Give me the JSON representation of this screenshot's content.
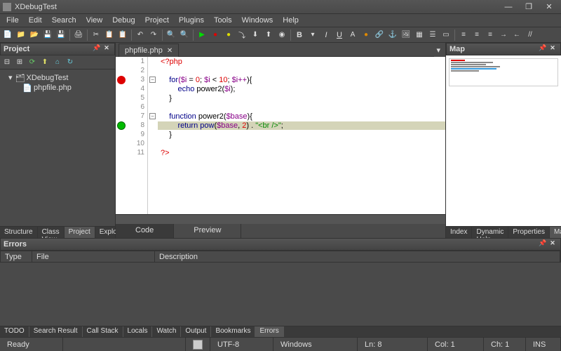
{
  "title": "XDebugTest",
  "menu": [
    "File",
    "Edit",
    "Search",
    "View",
    "Debug",
    "Project",
    "Plugins",
    "Tools",
    "Windows",
    "Help"
  ],
  "left_panel": {
    "title": "Project"
  },
  "tree": {
    "root": "XDebugTest",
    "file": "phpfile.php"
  },
  "left_tabs": [
    "Structure",
    "Class View",
    "Project",
    "Explorer"
  ],
  "left_tab_active": "Project",
  "file_tab": "phpfile.php",
  "code": {
    "l1": "<?php",
    "l3a": "for",
    "l3b": "($i",
    "l3c": " = ",
    "l3d": "0",
    "l3e": "; ",
    "l3f": "$i",
    "l3g": " < ",
    "l3h": "10",
    "l3i": "; ",
    "l3j": "$i++",
    "l3k": "){",
    "l4a": "echo",
    "l4b": " power2(",
    "l4c": "$i",
    "l4d": ");",
    "l5": "}",
    "l7a": "function",
    "l7b": " power2(",
    "l7c": "$base",
    "l7d": "){",
    "l8a": "return",
    "l8b": " pow",
    "l8c": "(",
    "l8d": "$base",
    "l8e": ", ",
    "l8f": "2",
    "l8g": ") . ",
    "l8h": "\"<br />\"",
    "l8i": ";",
    "l9": "}",
    "l11": "?>"
  },
  "lines": [
    "1",
    "2",
    "3",
    "4",
    "5",
    "6",
    "7",
    "8",
    "9",
    "10",
    "11"
  ],
  "view_tabs": [
    "Code",
    "Preview"
  ],
  "view_tab_active": "Code",
  "right_panel": {
    "title": "Map"
  },
  "right_tabs": [
    "Index",
    "Dynamic Help",
    "Properties",
    "Map"
  ],
  "right_tab_active": "Map",
  "errors_panel": {
    "title": "Errors",
    "cols": [
      "Type",
      "File",
      "Description"
    ]
  },
  "bottom_tabs": [
    "TODO",
    "Search Result",
    "Call Stack",
    "Locals",
    "Watch",
    "Output",
    "Bookmarks",
    "Errors"
  ],
  "bottom_tab_active": "Errors",
  "status": {
    "ready": "Ready",
    "enc": "UTF-8",
    "eol": "Windows",
    "ln": "Ln: 8",
    "col": "Col: 1",
    "ch": "Ch: 1",
    "ins": "INS"
  }
}
